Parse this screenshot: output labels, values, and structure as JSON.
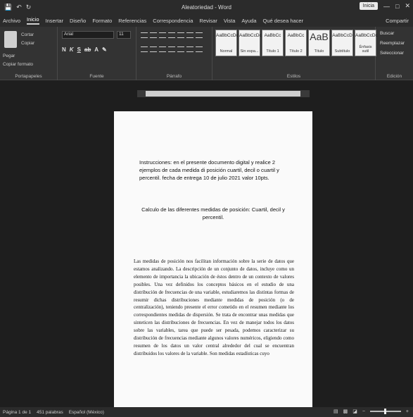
{
  "titlebar": {
    "title": "Aleatoriedad - Word",
    "signin": "Inicia",
    "quick_access": [
      "save-icon",
      "undo-icon",
      "redo-icon"
    ]
  },
  "tabs": [
    "Archivo",
    "Inicio",
    "Insertar",
    "Diseño",
    "Formato",
    "Referencias",
    "Correspondencia",
    "Revisar",
    "Vista",
    "Ayuda",
    "Qué desea hacer"
  ],
  "share_label": "Compartir",
  "ribbon": {
    "clipboard": {
      "paste_label": "Pegar",
      "cut_label": "Cortar",
      "copy_label": "Copiar",
      "format_painter_label": "Copiar formato",
      "group_label": "Portapapeles"
    },
    "font": {
      "font_name": "Arial",
      "font_size": "11",
      "group_label": "Fuente"
    },
    "paragraph": {
      "group_label": "Párrafo"
    },
    "styles": {
      "group_label": "Estilos",
      "items": [
        {
          "sample": "AaBbCcDc",
          "name": "Normal"
        },
        {
          "sample": "AaBbCcDc",
          "name": "Sin espa..."
        },
        {
          "sample": "AaBbCc",
          "name": "Título 1"
        },
        {
          "sample": "AaBbCc",
          "name": "Título 2"
        },
        {
          "sample": "AaB",
          "name": "Título"
        },
        {
          "sample": "AaBbCcD",
          "name": "Subtítulo"
        },
        {
          "sample": "AaBbCcDc",
          "name": "Énfasis sutil"
        }
      ]
    },
    "editing": {
      "find_label": "Buscar",
      "replace_label": "Reemplazar",
      "select_label": "Seleccionar",
      "group_label": "Edición"
    }
  },
  "document": {
    "instructions": "Instrucciones: en el presente documento digital y realice 2 ejemplos de cada medida di posición cuartil, decil o cuartil y percentil. fecha de entrega 10 de julio 2021 valor 10pts.",
    "heading": "Calculo de las diferentes medidas de posición: Cuartil, decil y percentil.",
    "body": "Las medidas de posición nos facilitan información sobre la serie de datos que estamos analizando. La descripción de un conjunto de datos, incluye como un elemento de importancia la ubicación de éstos dentro de un contexto de valores posibles. Una vez definidos los conceptos básicos en el estudio de una distribución de frecuencias de una variable, estudiaremos las distintas formas de resumir dichas distribuciones mediante medidas de posición (o de centralización), teniendo presente el error cometido en el resumen mediante los correspondientes medidas de dispersión. Se trata de encontrar unas medidas que sinteticen las distribuciones de frecuencias. En vez de manejar todos los datos sobre las variables, tarea que puede ser pesada, podemos caracterizar su distribución de frecuencias mediante algunos valores numéricos, eligiendo como resumen de los datos un valor central alrededor del cual se encuentran distribuidos los valores de la variable. Son medidas estadísticas cuyo"
  },
  "statusbar": {
    "page": "Página 1 de 1",
    "words": "451 palabras",
    "language": "Español (México)"
  },
  "colors": {
    "ribbon_bg": "#333333",
    "titlebar_bg": "#2b2b2b",
    "page_bg": "#fafafa"
  }
}
